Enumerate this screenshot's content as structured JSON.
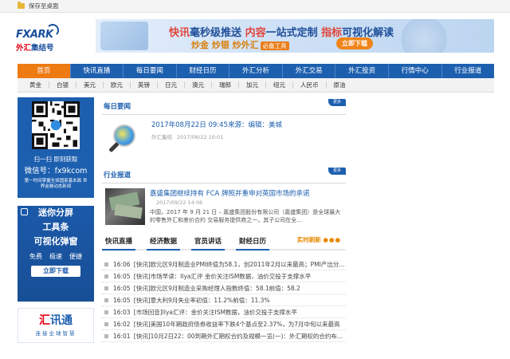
{
  "topbar": {
    "save_label": "保存至桌面"
  },
  "logo": {
    "text_en": "FXARK",
    "text_cn_a": "外汇",
    "text_cn_b": "集结号"
  },
  "banner": {
    "line1_a": "快讯",
    "line1_b": "毫秒级推送",
    "line1_c": "内容",
    "line1_d": "一站式定制",
    "line1_e": "指标",
    "line1_f": "可视化解读",
    "line2": "炒金   炒银   炒外汇",
    "line2_tag": "必备工具",
    "download_label": "立即下载"
  },
  "nav": {
    "items": [
      "首页",
      "快讯直播",
      "每日要闻",
      "财经日历",
      "外汇分析",
      "外汇交易",
      "外汇投资",
      "行情中心",
      "行业报道"
    ]
  },
  "currencies": [
    "黄金",
    "白银",
    "美元",
    "欧元",
    "英镑",
    "日元",
    "澳元",
    "瑞郎",
    "加元",
    "纽元",
    "人民币",
    "原油"
  ],
  "sidebar": {
    "qr": {
      "scan_text": "扫一扫  即刻获取",
      "wechat_text": "微信号：fx9kcom",
      "sub_text": "第一时间掌握全球国家基本面 世界金融动态新闻"
    },
    "ad1": {
      "line1": "迷你分屏",
      "line2": "工具条",
      "line3": "可视化弹窗",
      "features": [
        "免费",
        "极速",
        "便捷"
      ],
      "download_label": "立即下载"
    },
    "ad2": {
      "name_a": "汇",
      "name_b": "讯通",
      "slogan": "连接全球智慧"
    }
  },
  "daily_news": {
    "title": "每日要闻",
    "more_label": "更多",
    "headline": "2017年08月22日 09:45来源：编辑：美城",
    "meta_source": "外汇集结",
    "meta_time": "2017/08/22 10:01"
  },
  "industry": {
    "title": "行业报道",
    "more_label": "更多",
    "headline": "嘉盛集团继续持有 FCA 牌照并重申对英国市场的承诺",
    "date": "2017/09/22 14:06",
    "summary": "中国，2017 年 9 月 21 日 – 嘉盛集团股份有限公司（嘉盛集团）是全球最大的零售外汇和差价合约 交易服务提供商之一，其子公司在全..."
  },
  "tabs": {
    "items": [
      "快讯直播",
      "经济数据",
      "官员讲话",
      "财经日历"
    ],
    "live_label": "实时刷新"
  },
  "flash": [
    {
      "time": "16:06",
      "text": "[快讯]欧元区9月制造业PMI终值为58.1，创2011年2月以来最高；PMI产出分..."
    },
    {
      "time": "16:05",
      "text": "[快讯]市场早读：Ilya汇评  金价关注ISM数据，油价交投于支撑水平"
    },
    {
      "time": "16:05",
      "text": "[快讯]欧元区9月制造业采购经理人指数终值：58.1前值：58.2"
    },
    {
      "time": "16:05",
      "text": "[快讯]意大利9月失业率初值：11.2%前值：11.3%"
    },
    {
      "time": "16:03",
      "text": "[市场回音]Ilya汇评：金价关注ISM数据，油价交投于支撑水平"
    },
    {
      "time": "16:02",
      "text": "[快讯]美国10年期政府债券收益率下跌4个基点至2.37%，为7月中旬以来最高"
    },
    {
      "time": "16:01",
      "text": "[快讯]10月2日22：00到期外汇期权合约及规模一览(一)：外汇期权的合约布局..."
    }
  ]
}
